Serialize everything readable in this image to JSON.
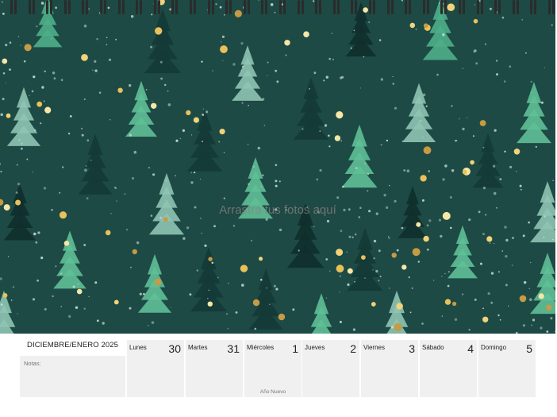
{
  "photo": {
    "drop_hint": "Arrastra tus fotos aquí",
    "background_color": "#1d4a44"
  },
  "calendar": {
    "month_title": "DICIEMBRE/ENERO 2025",
    "notes_label": "Notas:",
    "days": [
      {
        "name": "Lunes",
        "number": "30",
        "holiday": ""
      },
      {
        "name": "Martes",
        "number": "31",
        "holiday": ""
      },
      {
        "name": "Miércoles",
        "number": "1",
        "holiday": "Año Nuevo"
      },
      {
        "name": "Jueves",
        "number": "2",
        "holiday": ""
      },
      {
        "name": "Viernes",
        "number": "3",
        "holiday": ""
      },
      {
        "name": "Sábado",
        "number": "4",
        "holiday": ""
      },
      {
        "name": "Domingo",
        "number": "5",
        "holiday": ""
      }
    ]
  }
}
